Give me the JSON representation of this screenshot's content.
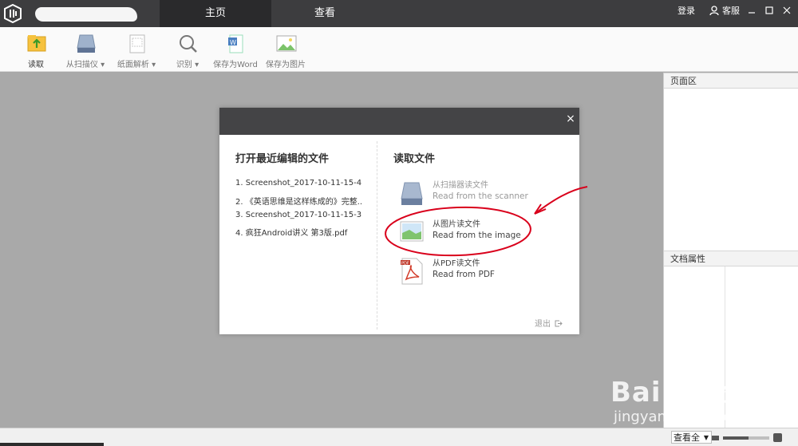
{
  "titlebar": {
    "app_title": "",
    "tabs": [
      {
        "label": "主页"
      },
      {
        "label": "查看"
      }
    ],
    "login": "登录",
    "feedback": "客服"
  },
  "ribbon": {
    "buttons": [
      {
        "label": "读取",
        "icon": "folder-open-icon"
      },
      {
        "label": "从扫描仪",
        "icon": "scanner-icon"
      },
      {
        "label": "纸面解析",
        "icon": "document-parse-icon"
      },
      {
        "label": "识别",
        "icon": "search-icon"
      },
      {
        "label": "保存为Word",
        "icon": "word-doc-icon"
      },
      {
        "label": "保存为图片",
        "icon": "image-icon"
      }
    ]
  },
  "right_panel": {
    "page_area_title": "页面区",
    "doc_props_title": "文档属性"
  },
  "dialog": {
    "recent_title": "打开最近编辑的文件",
    "recent_files": [
      "1.  Screenshot_2017-10-11-15-4...",
      "2.  《英语思维是这样练成的》完整...",
      "3.  Screenshot_2017-10-11-15-3...",
      "4.  疯狂Android讲义 第3版.pdf"
    ],
    "read_title": "读取文件",
    "options": [
      {
        "cn": "从扫描器读文件",
        "en": "Read from the scanner",
        "icon": "scanner-icon"
      },
      {
        "cn": "从图片读文件",
        "en": "Read from the image",
        "icon": "image-icon"
      },
      {
        "cn": "从PDF读文件",
        "en": "Read from PDF",
        "icon": "pdf-icon"
      }
    ],
    "exit_label": "退出",
    "close_glyph": "×"
  },
  "statusbar": {
    "zoom_label": "查看全",
    "zoom_level": 0.55
  },
  "watermark": {
    "brand": "Bai 经验",
    "url": "jingyan.baidu.com"
  },
  "colors": {
    "titlebar": "#3d3d3f",
    "active_tab": "#2a2a2c",
    "annotation": "#d9001b"
  }
}
